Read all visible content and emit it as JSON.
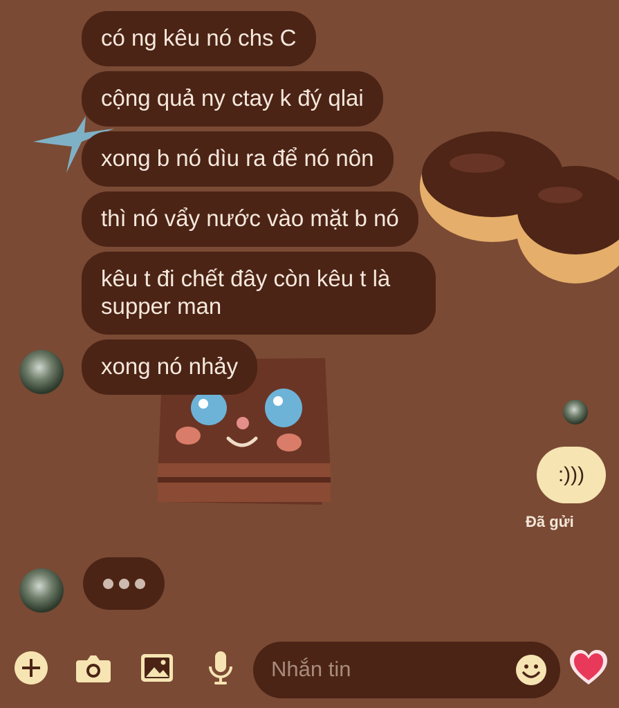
{
  "messages": [
    {
      "text": "có ng kêu nó chs C"
    },
    {
      "text": "cộng quả ny ctay k đý qlai"
    },
    {
      "text": "xong b nó dìu ra để nó nôn"
    },
    {
      "text": "thì nó vẩy nước vào mặt b nó"
    },
    {
      "text": "kêu t đi chết đây còn kêu t là supper man"
    },
    {
      "text": "xong nó nhảy"
    }
  ],
  "sent_voice": {
    "label": ":)))",
    "status": "Đã gửi"
  },
  "composer": {
    "placeholder": "Nhắn tin"
  },
  "icons": {
    "add": "plus-icon",
    "camera": "camera-icon",
    "gallery": "image-icon",
    "mic": "mic-icon",
    "emoji": "smiley-icon",
    "react": "heart-icon"
  },
  "colors": {
    "background": "#7a4a34",
    "bubble": "#4b2416",
    "bubble_text": "#f6e8dc",
    "accent": "#f6e4b2",
    "heart": "#e8395a"
  }
}
